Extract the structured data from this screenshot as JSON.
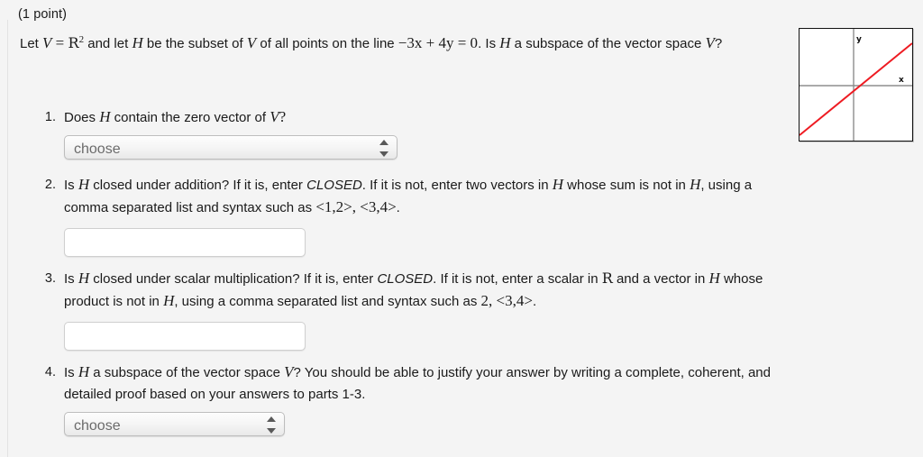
{
  "problem": {
    "points_label": "(1 point)",
    "stem": {
      "t1": "Let ",
      "v1": "V",
      "t2": " = ",
      "rset": "R",
      "exp": "2",
      "t3": " and let ",
      "v2": "H",
      "t4": " be the subset of ",
      "v3": "V",
      "t5": " of all points on the line ",
      "equation": "−3x + 4y = 0",
      "t6": ". Is ",
      "v4": "H",
      "t7": " a subspace of the vector space ",
      "v5": "V",
      "t8": "?"
    }
  },
  "questions": [
    {
      "number": "1.",
      "text_a": "Does ",
      "var_a": "H",
      "text_b": " contain the zero vector of ",
      "var_b": "V",
      "text_c": "?",
      "control": "select",
      "select_value": "choose"
    },
    {
      "number": "2.",
      "text_a": "Is ",
      "var_a": "H",
      "text_b": " closed under addition? If it is, enter ",
      "emph": "CLOSED",
      "text_c": ". If it is not, enter two vectors in ",
      "var_b": "H",
      "text_d": " whose sum is not in ",
      "var_c": "H",
      "text_e": ", using a comma separated list and syntax such as ",
      "syntax": "<1,2>, <3,4>",
      "text_f": ".",
      "control": "textbox",
      "input_value": "",
      "input_placeholder": ""
    },
    {
      "number": "3.",
      "text_a": "Is ",
      "var_a": "H",
      "text_b": " closed under scalar multiplication? If it is, enter ",
      "emph": "CLOSED",
      "text_c": ". If it is not, enter a scalar in ",
      "rset": "R",
      "text_d": " and a vector in ",
      "var_b": "H",
      "text_e": " whose product is not in ",
      "var_c": "H",
      "text_f": ", using a comma separated list and syntax such as ",
      "syntax": "2, <3,4>",
      "text_g": ".",
      "control": "textbox",
      "input_value": "",
      "input_placeholder": ""
    },
    {
      "number": "4.",
      "text_a": "Is ",
      "var_a": "H",
      "text_b": " a subspace of the vector space ",
      "var_b": "V",
      "text_c": "? You should be able to justify your answer by writing a complete, coherent, and detailed proof based on your answers to parts 1-3.",
      "control": "select",
      "select_value": "choose"
    }
  ],
  "figure": {
    "name": "line-graph",
    "x_axis_label": "x",
    "y_axis_label": "y",
    "line_color": "#ee1b22",
    "axis_color": "#888888",
    "border_color": "#111111",
    "background": "#ffffff"
  }
}
